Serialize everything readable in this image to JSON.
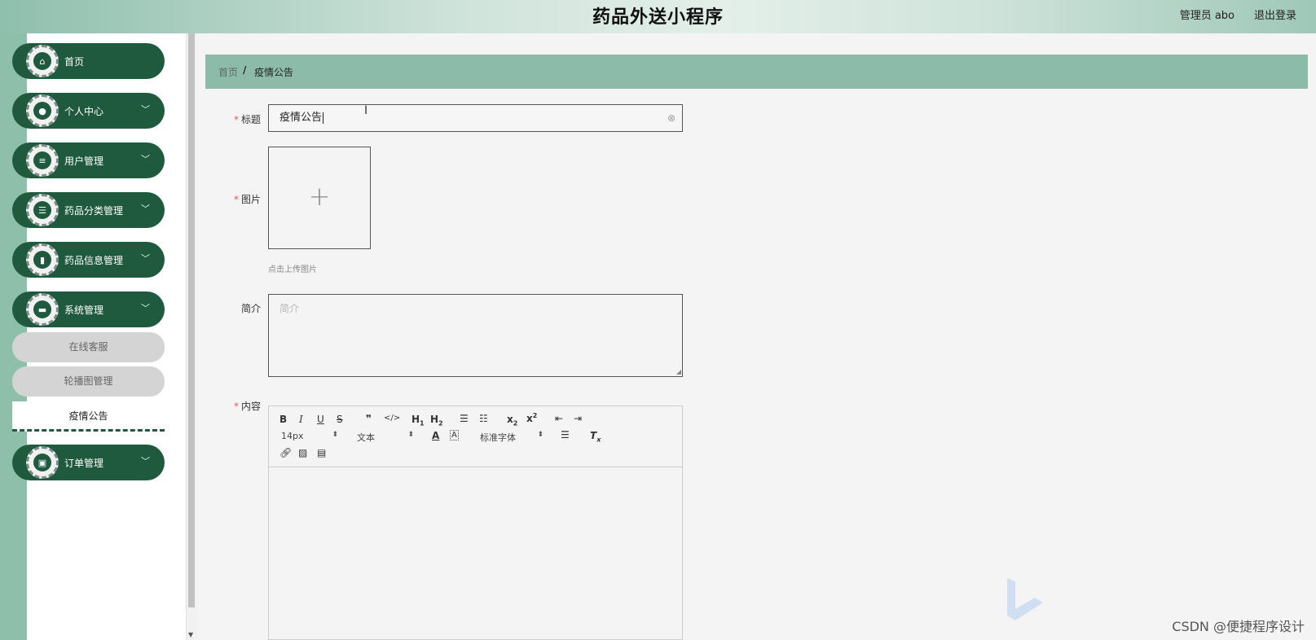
{
  "header": {
    "title": "药品外送小程序",
    "user_label": "管理员 abo",
    "logout_label": "退出登录"
  },
  "sidebar": {
    "items": [
      {
        "label": "首页",
        "icon": "home-icon",
        "glyph": "⌂"
      },
      {
        "label": "个人中心",
        "icon": "user-icon",
        "glyph": "●"
      },
      {
        "label": "用户管理",
        "icon": "sliders-icon",
        "glyph": "≡"
      },
      {
        "label": "药品分类管理",
        "icon": "list-icon",
        "glyph": "☰"
      },
      {
        "label": "药品信息管理",
        "icon": "bar-chart-icon",
        "glyph": "▮"
      },
      {
        "label": "系统管理",
        "icon": "monitor-icon",
        "glyph": "▬"
      },
      {
        "label": "订单管理",
        "icon": "clipboard-icon",
        "glyph": "▣"
      }
    ],
    "sub_items": [
      {
        "label": "在线客服"
      },
      {
        "label": "轮播图管理"
      },
      {
        "label": "疫情公告"
      }
    ]
  },
  "breadcrumb": {
    "home": "首页",
    "separator": "/",
    "current": "疫情公告"
  },
  "form": {
    "title_label": "标题",
    "title_value": "疫情公告",
    "image_label": "图片",
    "upload_hint": "点击上传图片",
    "intro_label": "简介",
    "intro_placeholder": "简介",
    "content_label": "内容"
  },
  "editor": {
    "font_size": "14px",
    "text_type": "文本",
    "font_family": "标准字体"
  },
  "watermark": "CSDN @便捷程序设计",
  "colors": {
    "sidebar_green": "#1f5a3f",
    "breadcrumb_green": "#8dbba9",
    "required_red": "#e05a5a"
  }
}
